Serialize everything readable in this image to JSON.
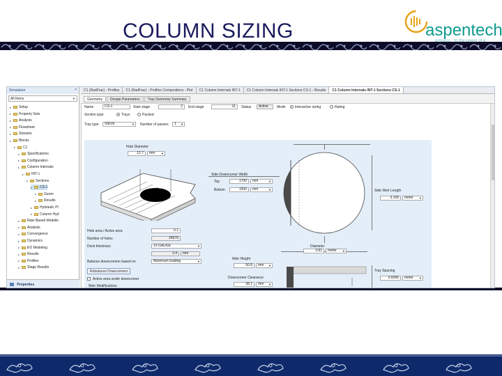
{
  "slide": {
    "title": "COLUMN SIZING",
    "logo": {
      "word": "aspentech",
      "tagline": "process... to the power of e"
    }
  },
  "nav": {
    "header": "Simulation",
    "filter": "All Items",
    "items": [
      {
        "label": "Setup",
        "level": 0
      },
      {
        "label": "Property Sets",
        "level": 0
      },
      {
        "label": "Analysis",
        "level": 0
      },
      {
        "label": "Flowsheet",
        "level": 0
      },
      {
        "label": "Streams",
        "level": 0
      },
      {
        "label": "Blocks",
        "level": 0
      },
      {
        "label": "C1",
        "level": 1
      },
      {
        "label": "Specifications",
        "level": 2
      },
      {
        "label": "Configuration",
        "level": 2
      },
      {
        "label": "Column Internals",
        "level": 2
      },
      {
        "label": "INT-1",
        "level": 3
      },
      {
        "label": "Sections",
        "level": 4
      },
      {
        "label": "CS-1",
        "level": 5
      },
      {
        "label": "Geom",
        "level": 6
      },
      {
        "label": "Results",
        "level": 6
      },
      {
        "label": "Hydraulic Pl",
        "level": 5
      },
      {
        "label": "Column Hyd",
        "level": 5
      },
      {
        "label": "Rate Based Modelin",
        "level": 2
      },
      {
        "label": "Analysis",
        "level": 2
      },
      {
        "label": "Convergence",
        "level": 2
      },
      {
        "label": "Dynamics",
        "level": 2
      },
      {
        "label": "EO Modeling",
        "level": 2
      },
      {
        "label": "Results",
        "level": 2
      },
      {
        "label": "Profiles",
        "level": 2
      },
      {
        "label": "Stage Results",
        "level": 2
      }
    ],
    "bottom": "Properties"
  },
  "tabs": [
    "C1 (RadFrac) - Profiles",
    "C1 (RadFrac) - Profiles Compositions - Plot",
    "C1 Column Internals INT-1",
    "C1 Column Internals INT-1 Sections CS-1 - Results",
    "C1 Column Internals INT-1 Sections CS-1"
  ],
  "subtabs": [
    "Geometry",
    "Design Parameters",
    "Tray Geometry Summary"
  ],
  "form": {
    "name_label": "Name",
    "name_value": "CS-1",
    "start_stage_label": "Start stage",
    "start_stage_value": "2",
    "end_stage_label": "End stage",
    "end_stage_value": "31",
    "status_label": "Status",
    "status_value": "Active",
    "mode_label": "Mode",
    "mode_interactive": "Interactive sizing",
    "mode_rating": "Rating",
    "section_type_label": "Section type",
    "section_trays": "Trays",
    "section_packed": "Packed",
    "tray_type_label": "Tray type",
    "tray_type_value": "SIEVE",
    "passes_label": "Number of passes",
    "passes_value": "1"
  },
  "geometry": {
    "hole_diameter_label": "Hole Diameter",
    "hole_diameter_value": "12.7",
    "hole_diameter_unit": "mm",
    "hole_area_label": "Hole area / Active area",
    "hole_area_value": "0.1",
    "holes_label": "Number of holes",
    "holes_value": "24576",
    "deck_label": "Deck thickness",
    "deck_value": "10 GAUGE",
    "deck_mm_value": "3.4",
    "deck_mm_unit": "mm",
    "balance_label": "Balance downcomers based on",
    "balance_value": "Maximum loading",
    "rebalance_button": "Rebalance Downcomers",
    "active_area_label": "Active area under downcomer",
    "weir_mods_label": "Weir Modifications",
    "side_dc_label": "Side Downcomer Width",
    "top_label": "Top",
    "top_value": "1700",
    "top_unit": "mm",
    "bottom_label": "Bottom",
    "bottom_value": "1500",
    "bottom_unit": "mm",
    "side_weir_label": "Side Weir Length",
    "side_weir_value": "3.168",
    "side_weir_unit": "meter",
    "diameter_label": "Diameter",
    "diameter_value": "3.81",
    "diameter_unit": "meter",
    "weir_height_label": "Weir Height",
    "weir_height_value": "50.8",
    "weir_height_unit": "mm",
    "dc_clearance_label": "Downcomer Clearance",
    "dc_clearance_value": "38.1",
    "dc_clearance_unit": "mm",
    "tray_spacing_label": "Tray Spacing",
    "tray_spacing_value": "0.6096",
    "tray_spacing_unit": "meter"
  },
  "colors": {
    "title": "#1a1a5e",
    "brand": "#0f9b8e",
    "panel": "#e4eef9",
    "footer": "#0e2a6b"
  }
}
